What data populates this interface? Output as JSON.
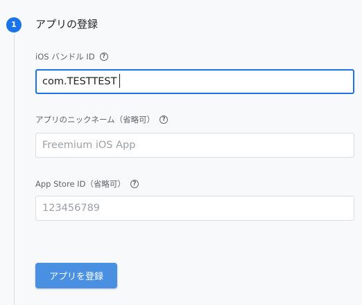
{
  "step": {
    "number": "1",
    "title": "アプリの登録"
  },
  "fields": {
    "bundle_id": {
      "label": "iOS バンドル ID",
      "value": "com.TESTTEST",
      "help_icon": "help-circle-icon"
    },
    "nickname": {
      "label": "アプリのニックネーム（省略可）",
      "placeholder": "Freemium iOS App",
      "help_icon": "help-circle-icon"
    },
    "app_store_id": {
      "label": "App Store ID（省略可）",
      "placeholder": "123456789",
      "help_icon": "help-circle-icon"
    }
  },
  "actions": {
    "register_label": "アプリを登録"
  },
  "colors": {
    "accent": "#1a73e8",
    "button": "#4a90e2",
    "background": "#f8f9fa"
  }
}
